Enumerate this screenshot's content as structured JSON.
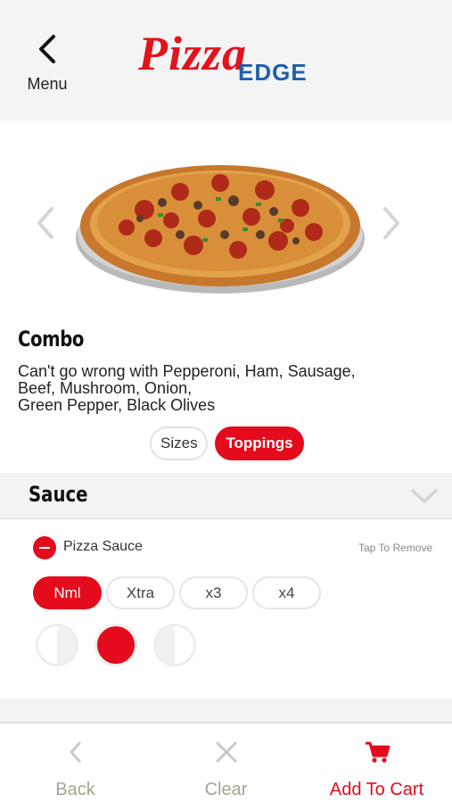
{
  "header": {
    "menu_label": "Menu",
    "logo_primary": "Pizza",
    "logo_secondary": "EDGE"
  },
  "product": {
    "name": "Combo",
    "description_lines": [
      "Can't go wrong with Pepperoni, Ham, Sausage,",
      "Beef, Mushroom, Onion,",
      "Green Pepper, Black Olives"
    ]
  },
  "tabs": [
    {
      "label": "Sizes",
      "active": false
    },
    {
      "label": "Toppings",
      "active": true
    }
  ],
  "section": {
    "title": "Sauce",
    "item": {
      "name": "Pizza Sauce",
      "remove_hint": "Tap To Remove",
      "amounts": [
        "Nml",
        "Xtra",
        "x3",
        "x4"
      ],
      "selected_amount": "Nml",
      "portions": [
        "left-half",
        "whole",
        "right-half"
      ],
      "selected_portion": "whole"
    }
  },
  "bottom_bar": {
    "back_label": "Back",
    "clear_label": "Clear",
    "cart_label": "Add To Cart"
  },
  "colors": {
    "accent": "#e30b1c",
    "logo_red": "#e3121b",
    "logo_blue": "#1c5fae",
    "muted_label": "#a6a58f"
  }
}
